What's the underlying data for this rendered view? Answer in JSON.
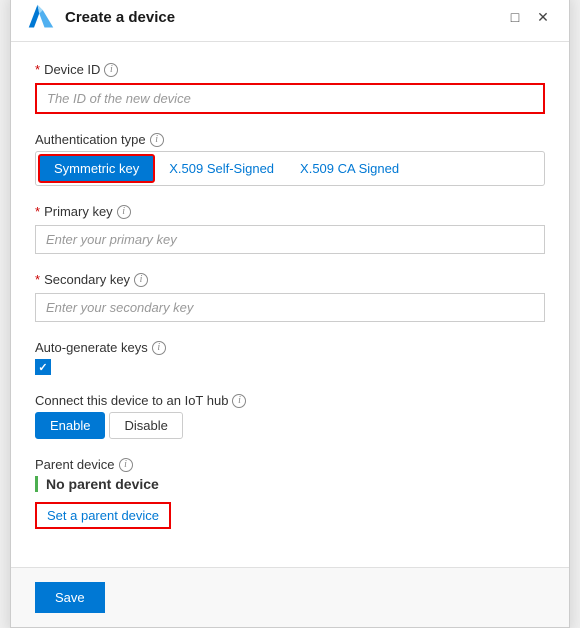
{
  "dialog": {
    "title": "Create a device",
    "logo_alt": "azure-logo"
  },
  "controls": {
    "minimize": "□",
    "close": "✕"
  },
  "form": {
    "device_id": {
      "label": "Device ID",
      "required": true,
      "placeholder": "The ID of the new device",
      "value": ""
    },
    "auth_type": {
      "label": "Authentication type",
      "options": [
        {
          "id": "symmetric",
          "label": "Symmetric key",
          "active": true
        },
        {
          "id": "x509_self",
          "label": "X.509 Self-Signed",
          "active": false
        },
        {
          "id": "x509_ca",
          "label": "X.509 CA Signed",
          "active": false
        }
      ]
    },
    "primary_key": {
      "label": "Primary key",
      "required": true,
      "placeholder": "Enter your primary key",
      "value": ""
    },
    "secondary_key": {
      "label": "Secondary key",
      "required": true,
      "placeholder": "Enter your secondary key",
      "value": ""
    },
    "auto_generate": {
      "label": "Auto-generate keys",
      "checked": true
    },
    "iot_connect": {
      "label": "Connect this device to an IoT hub",
      "options": [
        {
          "id": "enable",
          "label": "Enable",
          "active": true
        },
        {
          "id": "disable",
          "label": "Disable",
          "active": false
        }
      ]
    },
    "parent_device": {
      "label": "Parent device",
      "value": "No parent device",
      "action_label": "Set a parent device"
    }
  },
  "footer": {
    "save_label": "Save"
  }
}
